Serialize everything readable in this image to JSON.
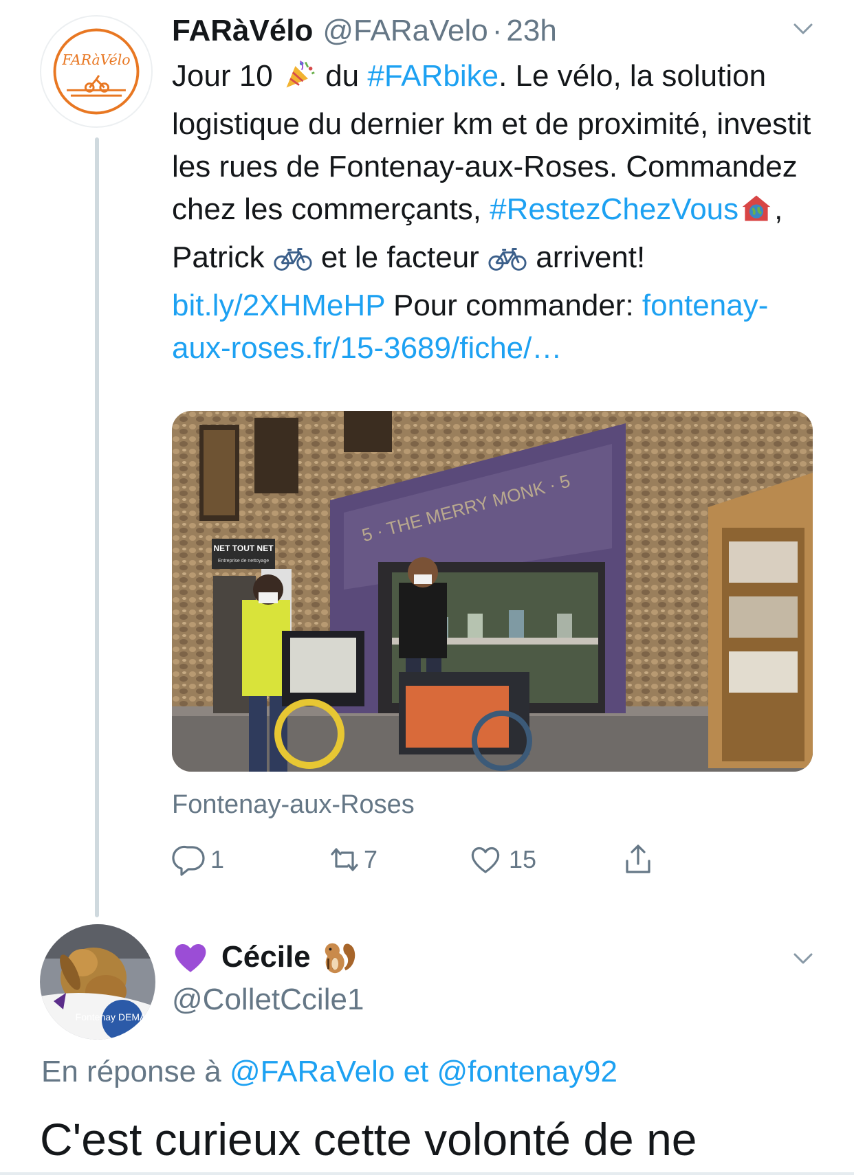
{
  "tweet": {
    "avatar_logo_text": "FARàVélo",
    "display_name": "FARàVélo",
    "handle": "@FARaVelo",
    "separator": "·",
    "time": "23h",
    "menu_icon": "chevron-down-icon",
    "text_segments": [
      {
        "type": "text",
        "text": "Jour 10 "
      },
      {
        "type": "emoji",
        "icon": "party-popper-emoji"
      },
      {
        "type": "text",
        "text": " du "
      },
      {
        "type": "link",
        "text": "#FARbike"
      },
      {
        "type": "text",
        "text": ". Le vélo, la solution logistique du dernier km et de proximité, investit les rues de Fontenay-aux-Roses. Commandez chez les commerçants, "
      },
      {
        "type": "link",
        "text": "#RestezChezVous"
      },
      {
        "type": "emoji",
        "icon": "house-with-globe-emoji"
      },
      {
        "type": "text",
        "text": ", Patrick "
      },
      {
        "type": "emoji",
        "icon": "bicycle-emoji"
      },
      {
        "type": "text",
        "text": " et le facteur "
      },
      {
        "type": "emoji",
        "icon": "bicycle-emoji"
      },
      {
        "type": "text",
        "text": " arrivent! "
      },
      {
        "type": "link",
        "text": "bit.ly/2XHMeHP"
      },
      {
        "type": "text",
        "text": " Pour commander: "
      },
      {
        "type": "link",
        "text": "fontenay-aux-roses.fr/15-3689/fiche/…"
      }
    ],
    "photo": {
      "shop_sign": "5 · THE MERRY MONK · 5",
      "side_sign": "NET TOUT NET",
      "side_sign_sub": "Entreprise de nettoyage"
    },
    "location": "Fontenay-aux-Roses",
    "actions": {
      "reply": {
        "icon": "reply-icon",
        "count": "1"
      },
      "retweet": {
        "icon": "retweet-icon",
        "count": "7"
      },
      "like": {
        "icon": "heart-icon",
        "count": "15"
      },
      "share": {
        "icon": "share-icon"
      }
    }
  },
  "reply": {
    "avatar_icon": "rabbit-avatar-icon",
    "avatar_text": "Fontenay DEMAIN",
    "display_name": "Cécile",
    "name_prefix_icon": "purple-heart-emoji",
    "name_suffix_icon": "chipmunk-emoji",
    "handle": "@ColletCcile1",
    "menu_icon": "chevron-down-icon",
    "reply_prefix": "En réponse à",
    "reply_user1": "@FARaVelo",
    "reply_connector": "et",
    "reply_user2": "@fontenay92",
    "text": "C'est curieux cette volonté de ne"
  },
  "colors": {
    "link": "#1da1f2",
    "secondary_text": "#657786",
    "primary_text": "#14171a",
    "logo_orange": "#e87722",
    "heart_purple": "#9b4dd6"
  }
}
